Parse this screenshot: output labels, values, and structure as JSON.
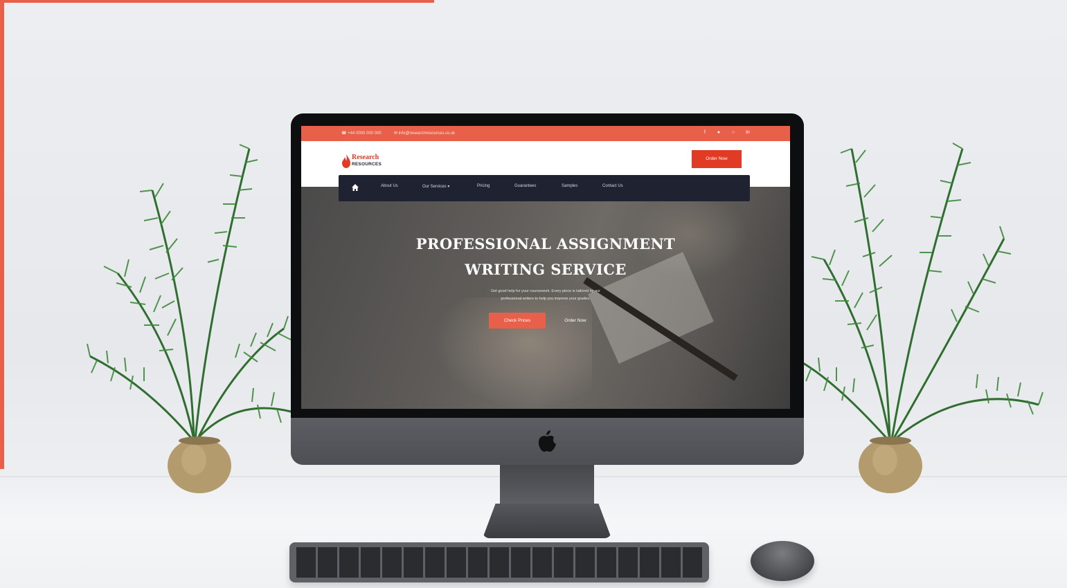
{
  "site": {
    "topbar": {
      "phone": "☎ +44 0000 000 000",
      "email": "✉ info@researchresources.co.uk",
      "social_icons": [
        "facebook-icon",
        "twitter-icon",
        "instagram-icon",
        "linkedin-icon"
      ]
    },
    "logo": {
      "line1": "Research",
      "line2": "RESOURCES"
    },
    "order_button": "Order Now",
    "nav": {
      "home_icon": "home-icon",
      "items": [
        "About Us",
        "Our Services ▾",
        "Pricing",
        "Guarantees",
        "Samples",
        "Contact Us"
      ]
    },
    "hero": {
      "title_line1": "PROFESSIONAL ASSIGNMENT",
      "title_line2": "WRITING SERVICE",
      "subtitle_line1": "Get good help for your coursework. Every piece is tailored by our",
      "subtitle_line2": "professional writers to help you improve your grades.",
      "primary_button": "Check Prices",
      "secondary_button": "Order Now"
    }
  },
  "colors": {
    "accent": "#e8604a",
    "nav_bg": "#1f2230",
    "order_button": "#e23b25"
  }
}
